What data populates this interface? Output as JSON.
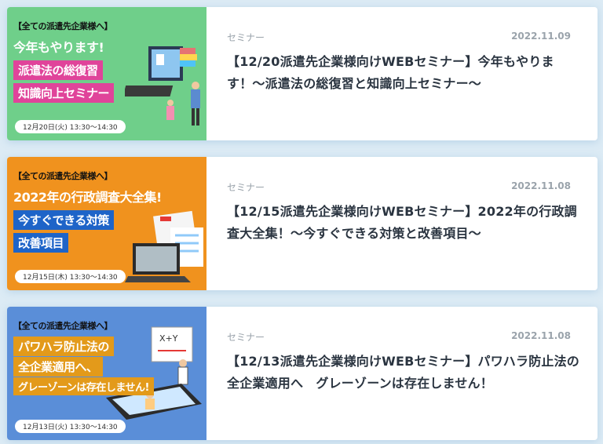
{
  "articles": [
    {
      "banner": {
        "tag": "【全ての派遣先企業様へ】",
        "line1": "今年もやります!",
        "line2": "派遣法の総復習",
        "line3": "知識向上セミナー",
        "date": "12月20日(火) 13:30〜14:30"
      },
      "category": "セミナー",
      "date": "2022.11.09",
      "title": "【12/20派遣先企業様向けWEBセミナー】今年もやります！〜派遣法の総復習と知識向上セミナー〜"
    },
    {
      "banner": {
        "tag": "【全ての派遣先企業様へ】",
        "line1": "2022年の行政調査大全集!",
        "line2": "今すぐできる対策",
        "line3": "改善項目",
        "date": "12月15日(木) 13:30〜14:30"
      },
      "category": "セミナー",
      "date": "2022.11.08",
      "title": "【12/15派遣先企業様向けWEBセミナー】2022年の行政調査大全集！〜今すぐできる対策と改善項目〜"
    },
    {
      "banner": {
        "tag": "【全ての派遣先企業様へ】",
        "line1": "パワハラ防止法の",
        "line2": "全企業適用へ、",
        "line3": "グレーゾーンは存在しません!",
        "date": "12月13日(火) 13:30〜14:30"
      },
      "category": "セミナー",
      "date": "2022.11.08",
      "title": "【12/13派遣先企業様向けWEBセミナー】パワハラ防止法の全企業適用へ　グレーゾーンは存在しません！"
    }
  ]
}
